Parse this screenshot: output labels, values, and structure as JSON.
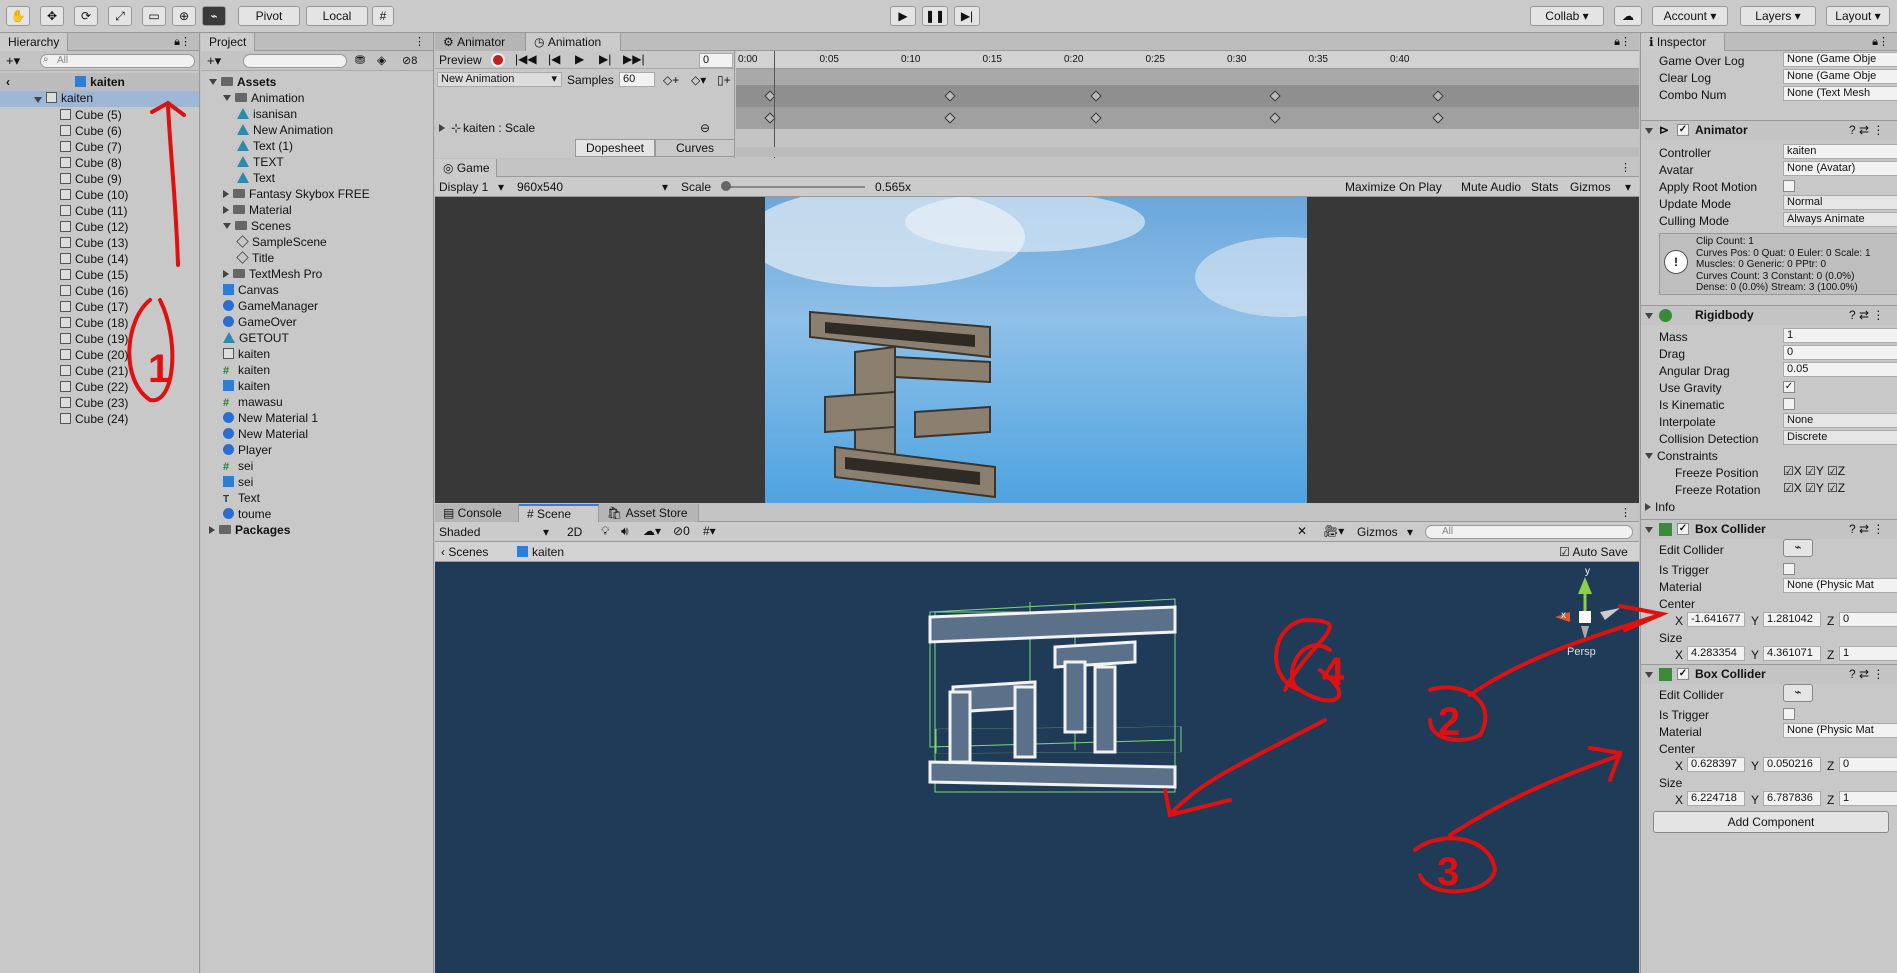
{
  "toolbar": {
    "pivot": "Pivot",
    "local": "Local",
    "collab": "Collab",
    "account": "Account",
    "layers": "Layers",
    "layout": "Layout"
  },
  "hierarchy": {
    "tab": "Hierarchy",
    "search_placeholder": "All",
    "scene_name": "kaiten",
    "root": "kaiten",
    "items": [
      "Cube (5)",
      "Cube (6)",
      "Cube (7)",
      "Cube (8)",
      "Cube (9)",
      "Cube (10)",
      "Cube (11)",
      "Cube (12)",
      "Cube (13)",
      "Cube (14)",
      "Cube (15)",
      "Cube (16)",
      "Cube (17)",
      "Cube (18)",
      "Cube (19)",
      "Cube (20)",
      "Cube (21)",
      "Cube (22)",
      "Cube (23)",
      "Cube (24)"
    ]
  },
  "project": {
    "tab": "Project",
    "hidden_count": "8",
    "items": [
      {
        "label": "Assets",
        "icon": "folder",
        "indent": 0,
        "bold": true
      },
      {
        "label": "Animation",
        "icon": "folder",
        "indent": 1
      },
      {
        "label": "isanisan",
        "icon": "anim",
        "indent": 2
      },
      {
        "label": "New Animation",
        "icon": "anim",
        "indent": 2
      },
      {
        "label": "Text (1)",
        "icon": "anim",
        "indent": 2
      },
      {
        "label": "TEXT",
        "icon": "anim",
        "indent": 2
      },
      {
        "label": "Text",
        "icon": "anim",
        "indent": 2
      },
      {
        "label": "Fantasy Skybox FREE",
        "icon": "folder",
        "indent": 1
      },
      {
        "label": "Material",
        "icon": "folder",
        "indent": 1
      },
      {
        "label": "Scenes",
        "icon": "folder",
        "indent": 1
      },
      {
        "label": "SampleScene",
        "icon": "scene",
        "indent": 2
      },
      {
        "label": "Title",
        "icon": "scene",
        "indent": 2
      },
      {
        "label": "TextMesh Pro",
        "icon": "folder",
        "indent": 1
      },
      {
        "label": "Canvas",
        "icon": "blue",
        "indent": 1
      },
      {
        "label": "GameManager",
        "icon": "sphere",
        "indent": 1
      },
      {
        "label": "GameOver",
        "icon": "sphere",
        "indent": 1
      },
      {
        "label": "GETOUT",
        "icon": "anim",
        "indent": 1
      },
      {
        "label": "kaiten",
        "icon": "cube",
        "indent": 1
      },
      {
        "label": "kaiten",
        "icon": "hash",
        "indent": 1
      },
      {
        "label": "kaiten",
        "icon": "blue",
        "indent": 1
      },
      {
        "label": "mawasu",
        "icon": "hash",
        "indent": 1
      },
      {
        "label": "New Material 1",
        "icon": "sphere",
        "indent": 1
      },
      {
        "label": "New Material",
        "icon": "sphere",
        "indent": 1
      },
      {
        "label": "Player",
        "icon": "sphere",
        "indent": 1
      },
      {
        "label": "sei",
        "icon": "hash",
        "indent": 1
      },
      {
        "label": "sei",
        "icon": "blue",
        "indent": 1
      },
      {
        "label": "Text",
        "icon": "text",
        "indent": 1
      },
      {
        "label": "toume",
        "icon": "sphere",
        "indent": 1
      },
      {
        "label": "Packages",
        "icon": "folder",
        "indent": 0,
        "bold": true
      }
    ]
  },
  "animation": {
    "tab_animator": "Animator",
    "tab_animation": "Animation",
    "preview": "Preview",
    "frame": "0",
    "clip": "New Animation",
    "samples_label": "Samples",
    "samples": "60",
    "property": "kaiten : Scale",
    "dopesheet": "Dopesheet",
    "curves": "Curves",
    "timeline": [
      "0:00",
      "0:05",
      "0:10",
      "0:15",
      "0:20",
      "0:25",
      "0:30",
      "0:35",
      "0:40"
    ]
  },
  "game": {
    "tab": "Game",
    "display": "Display 1",
    "resolution": "960x540",
    "scale_label": "Scale",
    "scale_value": "0.565x",
    "maximize": "Maximize On Play",
    "mute": "Mute Audio",
    "stats": "Stats",
    "gizmos": "Gizmos"
  },
  "scene": {
    "tab_console": "Console",
    "tab_scene": "Scene",
    "tab_store": "Asset Store",
    "shading": "Shaded",
    "mode2d": "2D",
    "hidden": "0",
    "gizmos": "Gizmos",
    "search": "All",
    "bc_scenes": "Scenes",
    "bc_obj": "kaiten",
    "autosave": "Auto Save",
    "persp": "Persp",
    "axis_x": "x",
    "axis_y": "y"
  },
  "annotations": {
    "n1": "1",
    "n2": "2",
    "n3": "3",
    "n4": "4"
  },
  "inspector": {
    "tab": "Inspector",
    "top_fields": [
      {
        "label": "Game Over Log",
        "value": "None (Game Obje"
      },
      {
        "label": "Clear Log",
        "value": "None (Game Obje"
      },
      {
        "label": "Combo Num",
        "value": "None (Text Mesh"
      }
    ],
    "animator": {
      "title": "Animator",
      "controller_label": "Controller",
      "controller": "kaiten",
      "avatar_label": "Avatar",
      "avatar": "None (Avatar)",
      "root_motion": "Apply Root Motion",
      "update_label": "Update Mode",
      "update": "Normal",
      "culling_label": "Culling Mode",
      "culling": "Always Animate",
      "info": [
        "Clip Count: 1",
        "Curves Pos: 0 Quat: 0 Euler: 0 Scale: 1",
        "Muscles: 0 Generic: 0 PPtr: 0",
        "Curves Count: 3 Constant: 0 (0.0%)",
        "Dense: 0 (0.0%) Stream: 3 (100.0%)"
      ]
    },
    "rigidbody": {
      "title": "Rigidbody",
      "mass_label": "Mass",
      "mass": "1",
      "drag_label": "Drag",
      "drag": "0",
      "angular_label": "Angular Drag",
      "angular": "0.05",
      "gravity": "Use Gravity",
      "kinematic": "Is Kinematic",
      "interp_label": "Interpolate",
      "interp": "None",
      "coll_label": "Collision Detection",
      "coll": "Discrete",
      "constraints": "Constraints",
      "freeze_pos": "Freeze Position",
      "freeze_rot": "Freeze Rotation",
      "axes": [
        "X",
        "Y",
        "Z"
      ],
      "info": "Info"
    },
    "box1": {
      "title": "Box Collider",
      "edit": "Edit Collider",
      "trigger": "Is Trigger",
      "material_label": "Material",
      "material": "None (Physic Mat",
      "center_label": "Center",
      "cx": "-1.641677",
      "cy": "1.281042",
      "cz": "0",
      "size_label": "Size",
      "sx": "4.283354",
      "sy": "4.361071",
      "sz": "1"
    },
    "box2": {
      "title": "Box Collider",
      "edit": "Edit Collider",
      "trigger": "Is Trigger",
      "material_label": "Material",
      "material": "None (Physic Mat",
      "center_label": "Center",
      "cx": "0.628397",
      "cy": "0.050216",
      "cz": "0",
      "size_label": "Size",
      "sx": "6.224718",
      "sy": "6.787836",
      "sz": "1"
    },
    "add_component": "Add Component"
  }
}
